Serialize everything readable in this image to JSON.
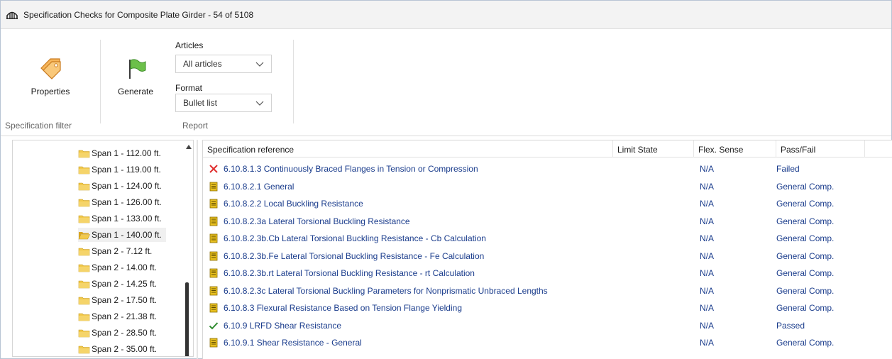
{
  "window": {
    "title": "Specification Checks for Composite Plate Girder - 54 of 5108"
  },
  "ribbon": {
    "properties_label": "Properties",
    "generate_label": "Generate",
    "articles_label": "Articles",
    "articles_value": "All articles",
    "format_label": "Format",
    "format_value": "Bullet list",
    "group_spec_filter": "Specification filter",
    "group_report": "Report"
  },
  "tree": {
    "items": [
      {
        "label": "Span 1 - 112.00 ft.",
        "selected": false
      },
      {
        "label": "Span 1 - 119.00 ft.",
        "selected": false
      },
      {
        "label": "Span 1 - 124.00 ft.",
        "selected": false
      },
      {
        "label": "Span 1 - 126.00 ft.",
        "selected": false
      },
      {
        "label": "Span 1 - 133.00 ft.",
        "selected": false
      },
      {
        "label": "Span 1 - 140.00 ft.",
        "selected": true
      },
      {
        "label": "Span 2 - 7.12 ft.",
        "selected": false
      },
      {
        "label": "Span 2 - 14.00 ft.",
        "selected": false
      },
      {
        "label": "Span 2 - 14.25 ft.",
        "selected": false
      },
      {
        "label": "Span 2 - 17.50 ft.",
        "selected": false
      },
      {
        "label": "Span 2 - 21.38 ft.",
        "selected": false
      },
      {
        "label": "Span 2 - 28.50 ft.",
        "selected": false
      },
      {
        "label": "Span 2 - 35.00 ft.",
        "selected": false
      }
    ]
  },
  "grid": {
    "columns": [
      "Specification reference",
      "Limit State",
      "Flex. Sense",
      "Pass/Fail"
    ],
    "rows": [
      {
        "icon": "failed-x-icon",
        "ref": "6.10.8.1.3 Continuously Braced Flanges in Tension or Compression",
        "limit": "",
        "flex": "N/A",
        "pass": "Failed"
      },
      {
        "icon": "document-icon",
        "ref": "6.10.8.2.1 General",
        "limit": "",
        "flex": "N/A",
        "pass": "General Comp."
      },
      {
        "icon": "document-icon",
        "ref": "6.10.8.2.2 Local Buckling Resistance",
        "limit": "",
        "flex": "N/A",
        "pass": "General Comp."
      },
      {
        "icon": "document-icon",
        "ref": "6.10.8.2.3a Lateral Torsional Buckling Resistance",
        "limit": "",
        "flex": "N/A",
        "pass": "General Comp."
      },
      {
        "icon": "document-icon",
        "ref": "6.10.8.2.3b.Cb Lateral Torsional Buckling Resistance - Cb Calculation",
        "limit": "",
        "flex": "N/A",
        "pass": "General Comp."
      },
      {
        "icon": "document-icon",
        "ref": "6.10.8.2.3b.Fe Lateral Torsional Buckling Resistance - Fe Calculation",
        "limit": "",
        "flex": "N/A",
        "pass": "General Comp."
      },
      {
        "icon": "document-icon",
        "ref": "6.10.8.2.3b.rt Lateral Torsional Buckling Resistance - rt Calculation",
        "limit": "",
        "flex": "N/A",
        "pass": "General Comp."
      },
      {
        "icon": "document-icon",
        "ref": "6.10.8.2.3c Lateral Torsional Buckling Parameters for Nonprismatic Unbraced Lengths",
        "limit": "",
        "flex": "N/A",
        "pass": "General Comp."
      },
      {
        "icon": "document-icon",
        "ref": "6.10.8.3 Flexural Resistance Based on Tension Flange Yielding",
        "limit": "",
        "flex": "N/A",
        "pass": "General Comp."
      },
      {
        "icon": "passed-check-icon",
        "ref": "6.10.9 LRFD Shear Resistance",
        "limit": "",
        "flex": "N/A",
        "pass": "Passed"
      },
      {
        "icon": "document-icon",
        "ref": "6.10.9.1 Shear Resistance - General",
        "limit": "",
        "flex": "N/A",
        "pass": "General Comp."
      }
    ]
  },
  "colors": {
    "link_text": "#1a3c8c",
    "failed": "#e03030",
    "passed": "#2e8b2e",
    "folder": "#f2c94c",
    "document": "#e8c020"
  }
}
